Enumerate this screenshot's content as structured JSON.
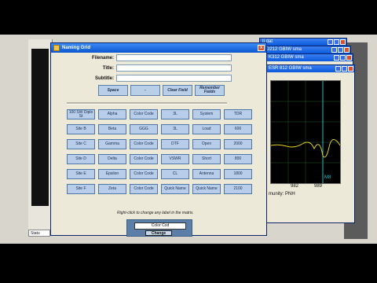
{
  "dialog": {
    "title": "Naming Grid",
    "close_glyph": "x"
  },
  "form": {
    "filename_label": "Filename:",
    "title_label": "Title:",
    "subtitle_label": "Subtitle:",
    "filename_value": "",
    "title_value": "",
    "subtitle_value": ""
  },
  "buttons": {
    "space": "Space",
    "dash": "-",
    "clear_field": "Clear Field",
    "remember_line1": "Remember",
    "remember_line2": "Fields"
  },
  "grid": [
    [
      "100 SW Diplo St",
      "Alpha",
      "Color Code",
      "3L",
      "System",
      "TDR"
    ],
    [
      "Site B",
      "Beta",
      "GGG",
      "3L",
      "Load",
      "600"
    ],
    [
      "Site C",
      "Gamma",
      "Color Code",
      "DTF",
      "Open",
      "2000"
    ],
    [
      "Site D",
      "Delta",
      "Color Code",
      "VSWR",
      "Short",
      "800"
    ],
    [
      "Site E",
      "Epsilon",
      "Color Code",
      "CL",
      "Antenna",
      "1800"
    ],
    [
      "Site F",
      "Zeta",
      "Color Code",
      "Quick Name",
      "Quick Name",
      "2100"
    ]
  ],
  "hint": "Right-click to change any label in the matrix.",
  "change_panel": {
    "input_value": "Color Cod",
    "button_label": "Change"
  },
  "background_windows": {
    "tab1": "Ii dat",
    "tab2": "D212 GBIW sma",
    "tab3": "K312 GBIW sma",
    "tab4": "ESR 812 GBIW sma",
    "plot_tick1": "982",
    "plot_tick2": "989",
    "plot_marker": "M8",
    "plot_caption": "munity: PNH"
  },
  "taskbar": {
    "status_text": "Statu"
  },
  "colors": {
    "title_bar": "#0b57d0",
    "cell_fill": "#b7cdea",
    "trace": "#e0d020"
  }
}
